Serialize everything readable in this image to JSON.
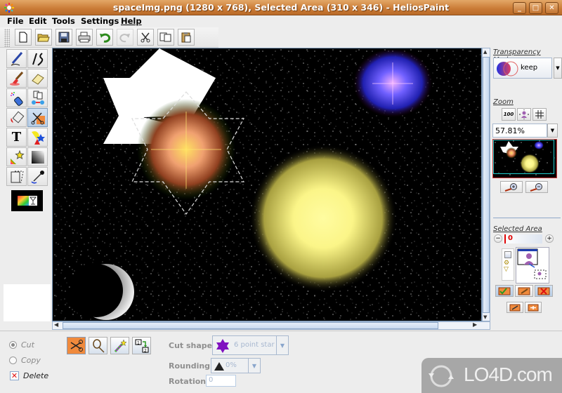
{
  "window": {
    "title": "spaceImg.png (1280 x 768), Selected Area (310 x 346) - HeliosPaint",
    "controls": {
      "minimize": "_",
      "maximize": "□",
      "close": "✕"
    }
  },
  "menubar": {
    "items": [
      {
        "label": "File"
      },
      {
        "label": "Edit"
      },
      {
        "label": "Tools"
      },
      {
        "label": "Settings"
      },
      {
        "label": "Help"
      }
    ]
  },
  "toolbar": {
    "buttons": [
      {
        "name": "new-file",
        "icon": "new-file-icon"
      },
      {
        "name": "open-file",
        "icon": "folder-icon"
      },
      {
        "name": "save",
        "icon": "floppy-icon"
      },
      {
        "name": "print",
        "icon": "printer-icon"
      },
      {
        "name": "undo",
        "icon": "undo-arrow-icon"
      },
      {
        "name": "redo",
        "icon": "redo-arrow-icon",
        "disabled": true
      },
      {
        "name": "cut",
        "icon": "scissors-icon"
      },
      {
        "name": "copy",
        "icon": "copy-icon"
      },
      {
        "name": "paste",
        "icon": "clipboard-icon"
      }
    ]
  },
  "tools": {
    "items": [
      {
        "name": "pen",
        "icon": "pen-icon"
      },
      {
        "name": "freehand-line",
        "icon": "curve-line-icon"
      },
      {
        "name": "paint-brush",
        "icon": "brush-icon"
      },
      {
        "name": "eraser",
        "icon": "eraser-icon"
      },
      {
        "name": "spray",
        "icon": "spray-can-icon"
      },
      {
        "name": "clone",
        "icon": "clone-icon"
      },
      {
        "name": "fill",
        "icon": "paint-bucket-icon"
      },
      {
        "name": "select-cut",
        "icon": "scissors-select-icon",
        "selected": true
      },
      {
        "name": "text",
        "icon": "text-icon",
        "glyph": "T"
      },
      {
        "name": "shapes",
        "icon": "shapes-icon"
      },
      {
        "name": "effects",
        "icon": "magic-star-icon"
      },
      {
        "name": "gradient",
        "icon": "gradient-icon"
      },
      {
        "name": "transform",
        "icon": "skew-icon"
      },
      {
        "name": "color-picker",
        "icon": "eyedropper-icon"
      }
    ]
  },
  "right_panel": {
    "transparency": {
      "title": "Transparency Mode",
      "value": "keep"
    },
    "zoom": {
      "title": "Zoom",
      "value": "57.81%",
      "button_100": "100"
    },
    "selected_area": {
      "title": "Selected Area",
      "slider_value": "0"
    }
  },
  "bottom": {
    "mode": {
      "cut_label": "Cut",
      "copy_label": "Copy",
      "delete_label": "Delete",
      "selected": "Cut",
      "delete_checked": true
    },
    "select_tools": [
      {
        "name": "scissors",
        "selected": true
      },
      {
        "name": "lasso"
      },
      {
        "name": "magic-wand"
      },
      {
        "name": "swap-layers"
      }
    ],
    "cut_shape": {
      "label": "Cut shape:",
      "value": "6 point star"
    },
    "rounding": {
      "label": "Rounding:",
      "value": "0%"
    },
    "rotation": {
      "label": "Rotation:",
      "value": "0"
    }
  },
  "colors": {
    "accent_title": "#c97a35",
    "selection": "#b8cde4",
    "active_tool": "#f08a3c"
  },
  "watermark": {
    "text": "LO4D.com"
  }
}
